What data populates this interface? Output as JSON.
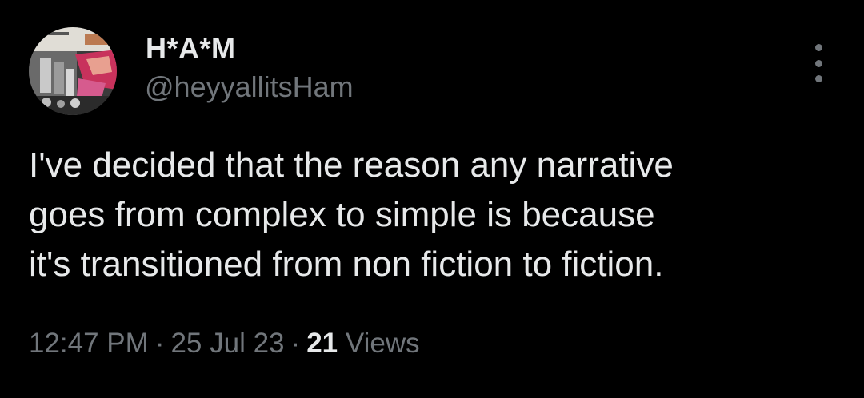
{
  "author": {
    "display_name": "H*A*M",
    "handle": "@heyyallitsHam"
  },
  "tweet": {
    "lines": [
      "I've decided that the reason any narrative",
      "goes from complex to simple is because",
      "it's transitioned from non fiction to fiction."
    ]
  },
  "meta": {
    "time": "12:47 PM",
    "separator": "·",
    "date": "25 Jul 23",
    "views_count": "21",
    "views_label": "Views"
  },
  "icons": {
    "more": "more-options-icon"
  },
  "colors": {
    "background": "#000000",
    "primary_text": "#e7e9ea",
    "secondary_text": "#71767b"
  }
}
